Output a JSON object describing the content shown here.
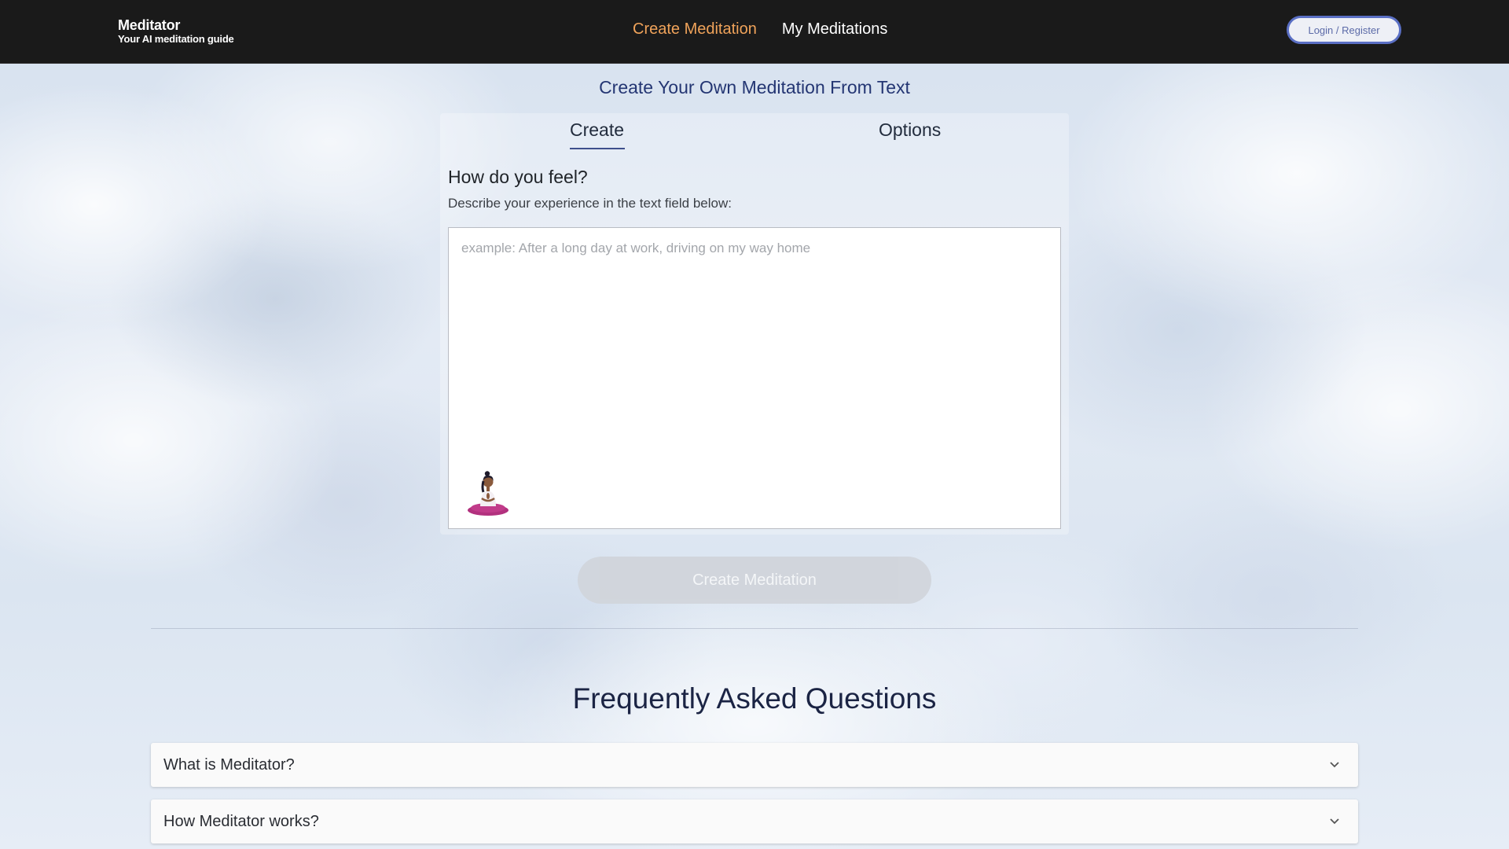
{
  "header": {
    "brand_name": "Meditator",
    "brand_tagline": "Your AI meditation guide",
    "nav": [
      {
        "label": "Create Meditation",
        "active": true
      },
      {
        "label": "My Meditations",
        "active": false
      }
    ],
    "login_label": "Login / Register"
  },
  "main": {
    "heading": "Create Your Own Meditation From Text",
    "tabs": [
      {
        "label": "Create",
        "selected": true
      },
      {
        "label": "Options",
        "selected": false
      }
    ],
    "prompt_title": "How do you feel?",
    "prompt_subtitle": "Describe your experience in the text field below:",
    "input": {
      "value": "",
      "placeholder": "example: After a long day at work, driving on my way home"
    },
    "create_button_label": "Create Meditation"
  },
  "faq": {
    "title": "Frequently Asked Questions",
    "items": [
      {
        "question": "What is Meditator?"
      },
      {
        "question": "How Meditator works?"
      }
    ]
  },
  "colors": {
    "header_bg": "#1a1a1a",
    "nav_active": "#f0a35a",
    "heading_blue": "#243673",
    "login_border": "#5a6fc4",
    "button_disabled": "#d1d5db"
  },
  "icons": [
    "meditating-person-icon",
    "chevron-down-icon"
  ]
}
